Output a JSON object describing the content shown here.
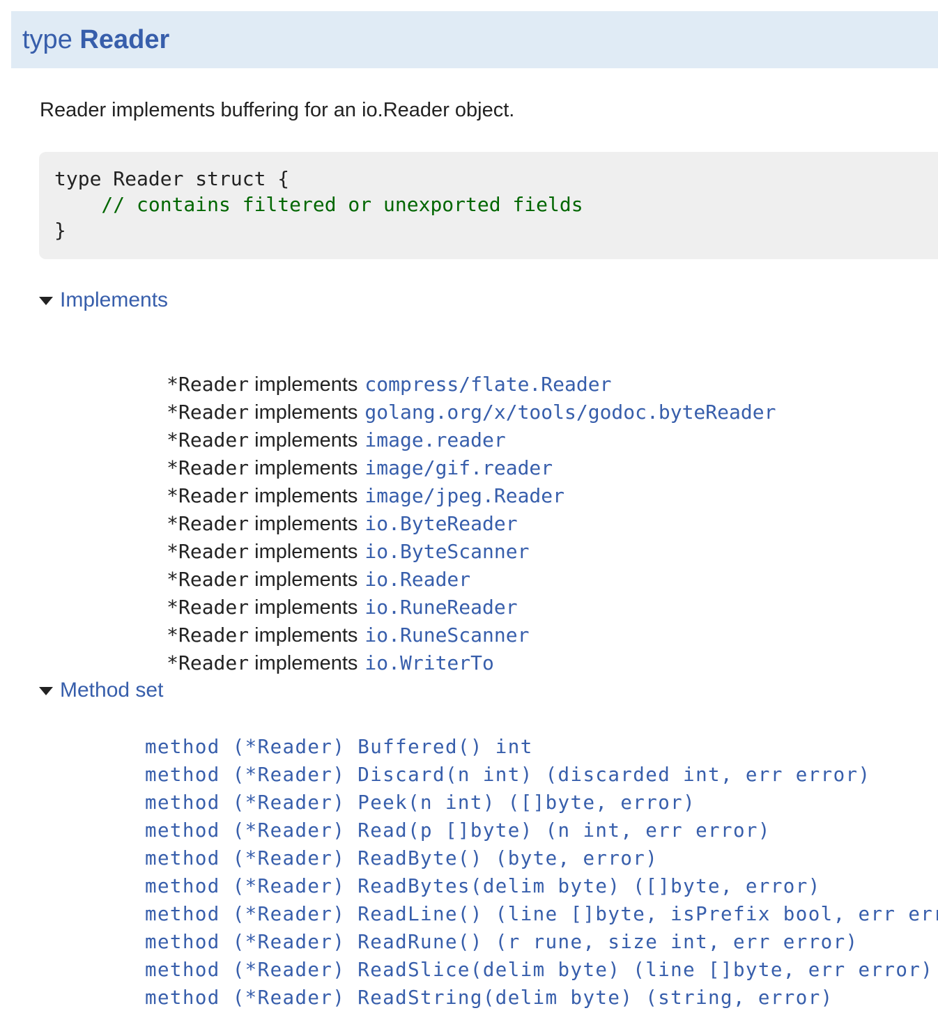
{
  "header": {
    "keyword": "type",
    "name": "Reader"
  },
  "description": "Reader implements buffering for an io.Reader object.",
  "code": {
    "line1": "type Reader struct {",
    "line2": "    // contains filtered or unexported fields",
    "line3": "}"
  },
  "implements": {
    "title": "Implements",
    "items": [
      {
        "subject": "*Reader",
        "verb": "implements",
        "target": "compress/flate.Reader"
      },
      {
        "subject": "*Reader",
        "verb": "implements",
        "target": "golang.org/x/tools/godoc.byteReader"
      },
      {
        "subject": "*Reader",
        "verb": "implements",
        "target": "image.reader"
      },
      {
        "subject": "*Reader",
        "verb": "implements",
        "target": "image/gif.reader"
      },
      {
        "subject": "*Reader",
        "verb": "implements",
        "target": "image/jpeg.Reader"
      },
      {
        "subject": "*Reader",
        "verb": "implements",
        "target": "io.ByteReader"
      },
      {
        "subject": "*Reader",
        "verb": "implements",
        "target": "io.ByteScanner"
      },
      {
        "subject": "*Reader",
        "verb": "implements",
        "target": "io.Reader"
      },
      {
        "subject": "*Reader",
        "verb": "implements",
        "target": "io.RuneReader"
      },
      {
        "subject": "*Reader",
        "verb": "implements",
        "target": "io.RuneScanner"
      },
      {
        "subject": "*Reader",
        "verb": "implements",
        "target": "io.WriterTo"
      }
    ]
  },
  "method_set": {
    "title": "Method set",
    "items": [
      "method (*Reader) Buffered() int",
      "method (*Reader) Discard(n int) (discarded int, err error)",
      "method (*Reader) Peek(n int) ([]byte, error)",
      "method (*Reader) Read(p []byte) (n int, err error)",
      "method (*Reader) ReadByte() (byte, error)",
      "method (*Reader) ReadBytes(delim byte) ([]byte, error)",
      "method (*Reader) ReadLine() (line []byte, isPrefix bool, err error)",
      "method (*Reader) ReadRune() (r rune, size int, err error)",
      "method (*Reader) ReadSlice(delim byte) (line []byte, err error)",
      "method (*Reader) ReadString(delim byte) (string, error)"
    ]
  }
}
